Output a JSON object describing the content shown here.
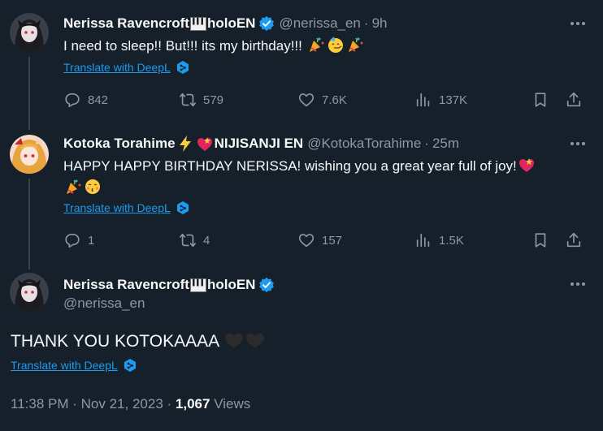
{
  "tweets": [
    {
      "display_name": "Nerissa Ravencroft",
      "name_suffix": "holoEN",
      "handle": "@nerissa_en",
      "time": "9h",
      "text": "I need to sleep!! But!!! its my birthday!!!",
      "translate": "Translate with DeepL",
      "actions": {
        "replies": "842",
        "retweets": "579",
        "likes": "7.6K",
        "views": "137K"
      }
    },
    {
      "display_name": "Kotoka Torahime",
      "name_suffix": "NIJISANJI EN",
      "handle": "@KotokaTorahime",
      "time": "25m",
      "text": "HAPPY HAPPY BIRTHDAY NERISSA! wishing you a great year full of joy!",
      "translate": "Translate with DeepL",
      "actions": {
        "replies": "1",
        "retweets": "4",
        "likes": "157",
        "views": "1.5K"
      }
    }
  ],
  "main": {
    "display_name": "Nerissa Ravencroft",
    "name_suffix": "holoEN",
    "handle": "@nerissa_en",
    "text": "THANK YOU KOTOKAAAA",
    "translate": "Translate with DeepL",
    "time": "11:38 PM",
    "date": "Nov 21, 2023",
    "views_count": "1,067",
    "views_label": "Views"
  },
  "colors": {
    "background": "#15202b",
    "text": "#f7f9f9",
    "muted": "#8b98a5",
    "link": "#1d9bf0",
    "verified": "#1d9bf0"
  },
  "icons": [
    "more-icon",
    "reply-icon",
    "retweet-icon",
    "like-icon",
    "views-icon",
    "bookmark-icon",
    "share-icon",
    "verified-icon",
    "deepl-icon"
  ]
}
